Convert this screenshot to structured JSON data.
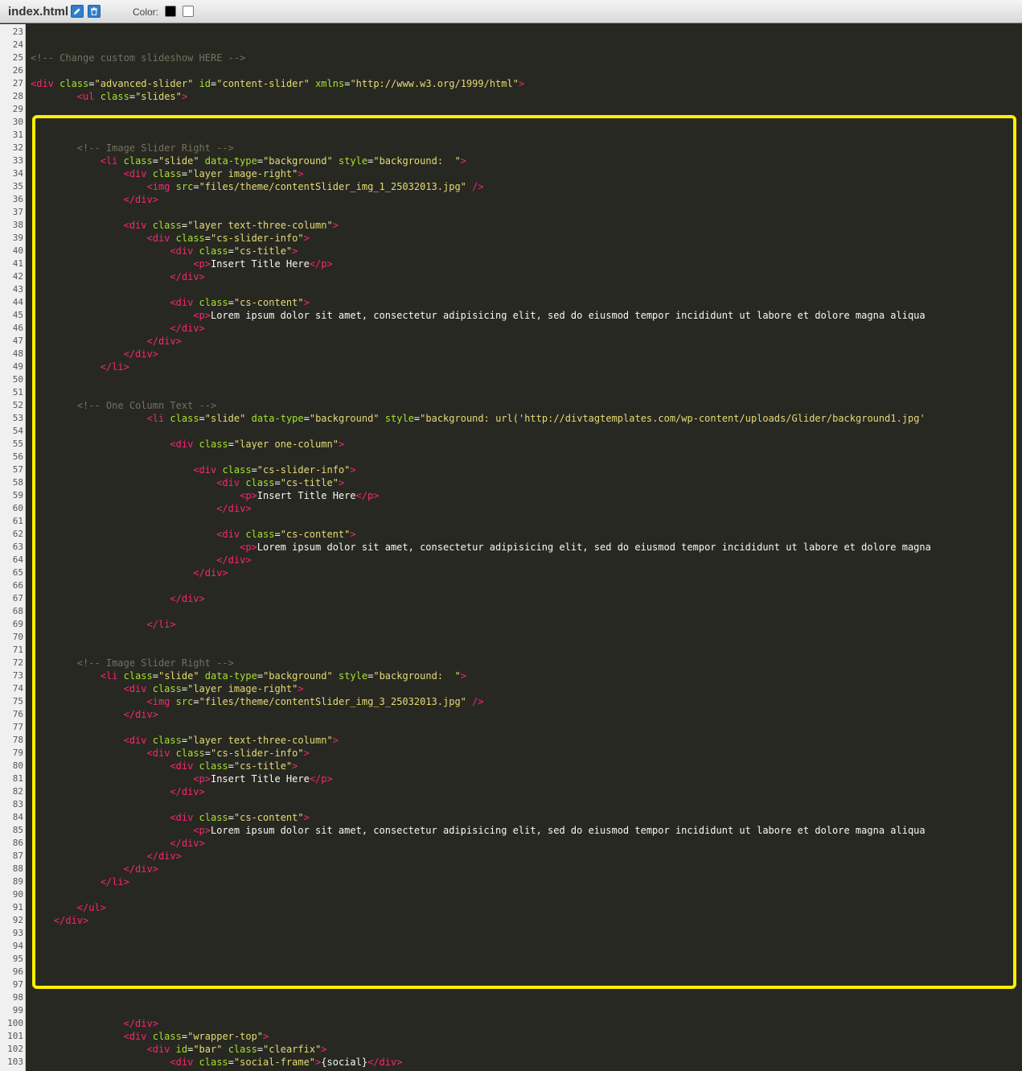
{
  "toolbar": {
    "filename": "index.html",
    "edit_icon": "pencil-icon",
    "delete_icon": "trash-icon",
    "color_label": "Color:",
    "swatches": [
      "#000000",
      "#ffffff"
    ]
  },
  "editor": {
    "first_line": 23,
    "colors": {
      "tag": "#f92672",
      "attr": "#a6e22e",
      "string": "#e6db74",
      "comment": "#75715e",
      "text": "#f8f8f2",
      "background": "#272822",
      "highlight": "#ffee00"
    },
    "lines": [
      "",
      "",
      "<!-- Change custom slideshow HERE -->",
      "",
      "<div class=\"advanced-slider\" id=\"content-slider\" xmlns=\"http://www.w3.org/1999/html\">",
      "        <ul class=\"slides\">",
      "",
      "",
      "",
      "        <!-- Image Slider Right -->",
      "            <li class=\"slide\" data-type=\"background\" style=\"background:  \">",
      "                <div class=\"layer image-right\">",
      "                    <img src=\"files/theme/contentSlider_img_1_25032013.jpg\" />",
      "                </div>",
      "",
      "                <div class=\"layer text-three-column\">",
      "                    <div class=\"cs-slider-info\">",
      "                        <div class=\"cs-title\">",
      "                            <p>Insert Title Here</p>",
      "                        </div>",
      "",
      "                        <div class=\"cs-content\">",
      "                            <p>Lorem ipsum dolor sit amet, consectetur adipisicing elit, sed do eiusmod tempor incididunt ut labore et dolore magna aliqua",
      "                        </div>",
      "                    </div>",
      "                </div>",
      "            </li>",
      "",
      "",
      "        <!-- One Column Text -->",
      "                    <li class=\"slide\" data-type=\"background\" style=\"background: url('http://divtagtemplates.com/wp-content/uploads/Glider/background1.jpg'",
      "",
      "                        <div class=\"layer one-column\">",
      "",
      "                            <div class=\"cs-slider-info\">",
      "                                <div class=\"cs-title\">",
      "                                    <p>Insert Title Here</p>",
      "                                </div>",
      "",
      "                                <div class=\"cs-content\">",
      "                                    <p>Lorem ipsum dolor sit amet, consectetur adipisicing elit, sed do eiusmod tempor incididunt ut labore et dolore magna",
      "                                </div>",
      "                            </div>",
      "",
      "                        </div>",
      "",
      "                    </li>",
      "",
      "",
      "        <!-- Image Slider Right -->",
      "            <li class=\"slide\" data-type=\"background\" style=\"background:  \">",
      "                <div class=\"layer image-right\">",
      "                    <img src=\"files/theme/contentSlider_img_3_25032013.jpg\" />",
      "                </div>",
      "",
      "                <div class=\"layer text-three-column\">",
      "                    <div class=\"cs-slider-info\">",
      "                        <div class=\"cs-title\">",
      "                            <p>Insert Title Here</p>",
      "                        </div>",
      "",
      "                        <div class=\"cs-content\">",
      "                            <p>Lorem ipsum dolor sit amet, consectetur adipisicing elit, sed do eiusmod tempor incididunt ut labore et dolore magna aliqua",
      "                        </div>",
      "                    </div>",
      "                </div>",
      "            </li>",
      "",
      "        </ul>",
      "    </div>",
      "",
      "",
      "",
      "",
      "",
      "",
      "",
      "                </div>",
      "                <div class=\"wrapper-top\">",
      "                    <div id=\"bar\" class=\"clearfix\">",
      "                        <div class=\"social-frame\">{social}</div>"
    ]
  }
}
